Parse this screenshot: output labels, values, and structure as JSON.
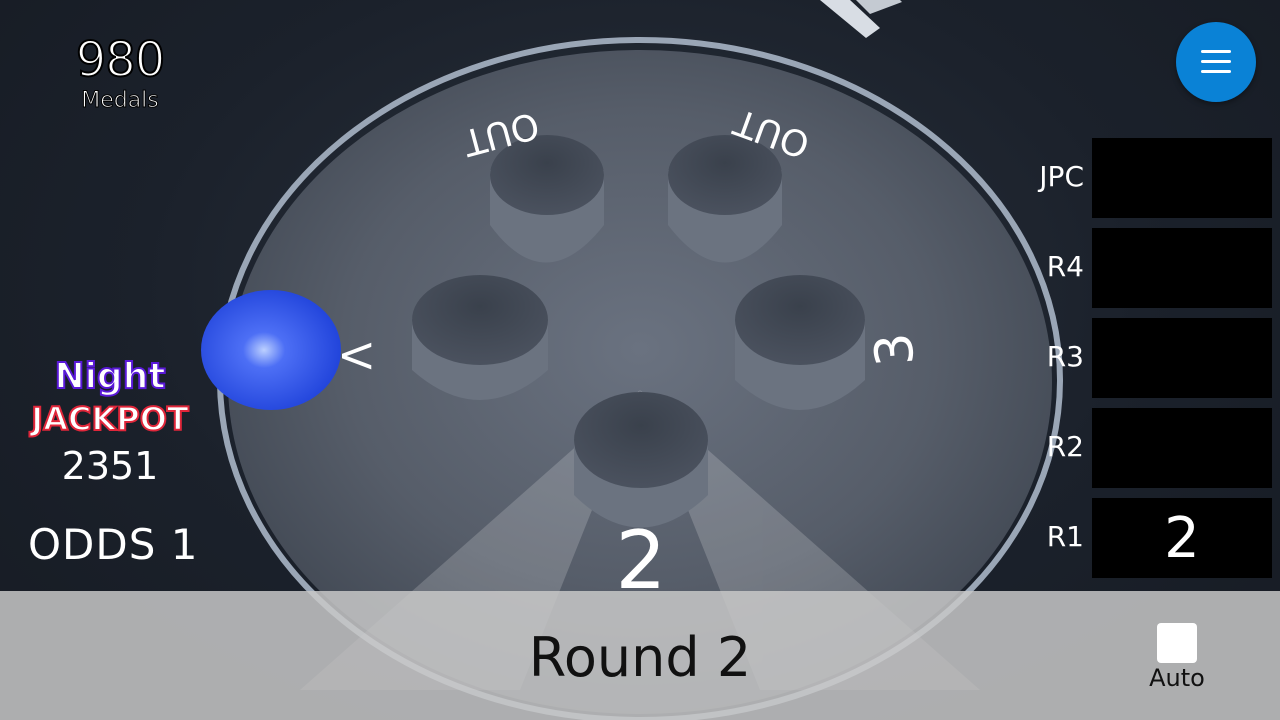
{
  "hud": {
    "medals_count": "980",
    "medals_label": "Medals",
    "jackpot_name": "Night",
    "jackpot_title": "JACKPOT",
    "jackpot_value": "2351",
    "odds": "ODDS 1"
  },
  "board": {
    "pocket_labels": [
      "OUT",
      "OUT",
      "3",
      "2",
      "V"
    ]
  },
  "right_panel": {
    "rows": [
      {
        "label": "JPC",
        "value": ""
      },
      {
        "label": "R4",
        "value": ""
      },
      {
        "label": "R3",
        "value": ""
      },
      {
        "label": "R2",
        "value": ""
      },
      {
        "label": "R1",
        "value": "2"
      }
    ]
  },
  "bottom": {
    "round_label": "Round 2",
    "auto_label": "Auto"
  },
  "colors": {
    "menu_button": "#0a82d6",
    "ball": "#2f55f0",
    "jackpot_night_outline": "#5a19d8",
    "jackpot_title_outline": "#e0263a"
  },
  "icons": {
    "menu": "hamburger-icon"
  }
}
